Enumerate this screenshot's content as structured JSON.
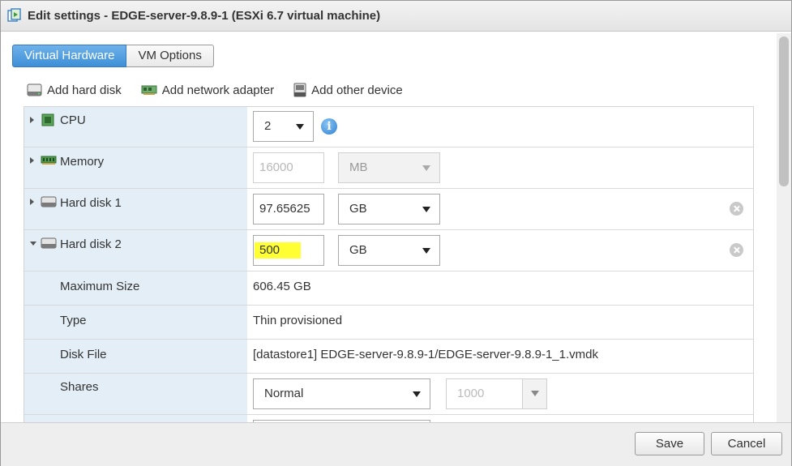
{
  "window": {
    "title": "Edit settings - EDGE-server-9.8.9-1 (ESXi 6.7 virtual machine)"
  },
  "tabs": [
    {
      "label": "Virtual Hardware",
      "active": true
    },
    {
      "label": "VM Options",
      "active": false
    }
  ],
  "toolbar": {
    "add_hard_disk": "Add hard disk",
    "add_network_adapter": "Add network adapter",
    "add_other_device": "Add other device"
  },
  "hardware": {
    "cpu": {
      "label": "CPU",
      "value": "2"
    },
    "memory": {
      "label": "Memory",
      "value": "16000",
      "unit": "MB"
    },
    "hard_disk_1": {
      "label": "Hard disk 1",
      "size": "97.65625",
      "unit": "GB"
    },
    "hard_disk_2": {
      "label": "Hard disk 2",
      "size": "500",
      "unit": "GB",
      "max_size_label": "Maximum Size",
      "max_size": "606.45 GB",
      "type_label": "Type",
      "type": "Thin provisioned",
      "disk_file_label": "Disk File",
      "disk_file": "[datastore1] EDGE-server-9.8.9-1/EDGE-server-9.8.9-1_1.vmdk",
      "shares_label": "Shares",
      "shares": "Normal",
      "shares_value": "1000"
    }
  },
  "footer": {
    "save": "Save",
    "cancel": "Cancel"
  },
  "colors": {
    "highlight": "#ffff33",
    "tab_active": "#3d8fd7",
    "label_column": "#e3eef6"
  }
}
